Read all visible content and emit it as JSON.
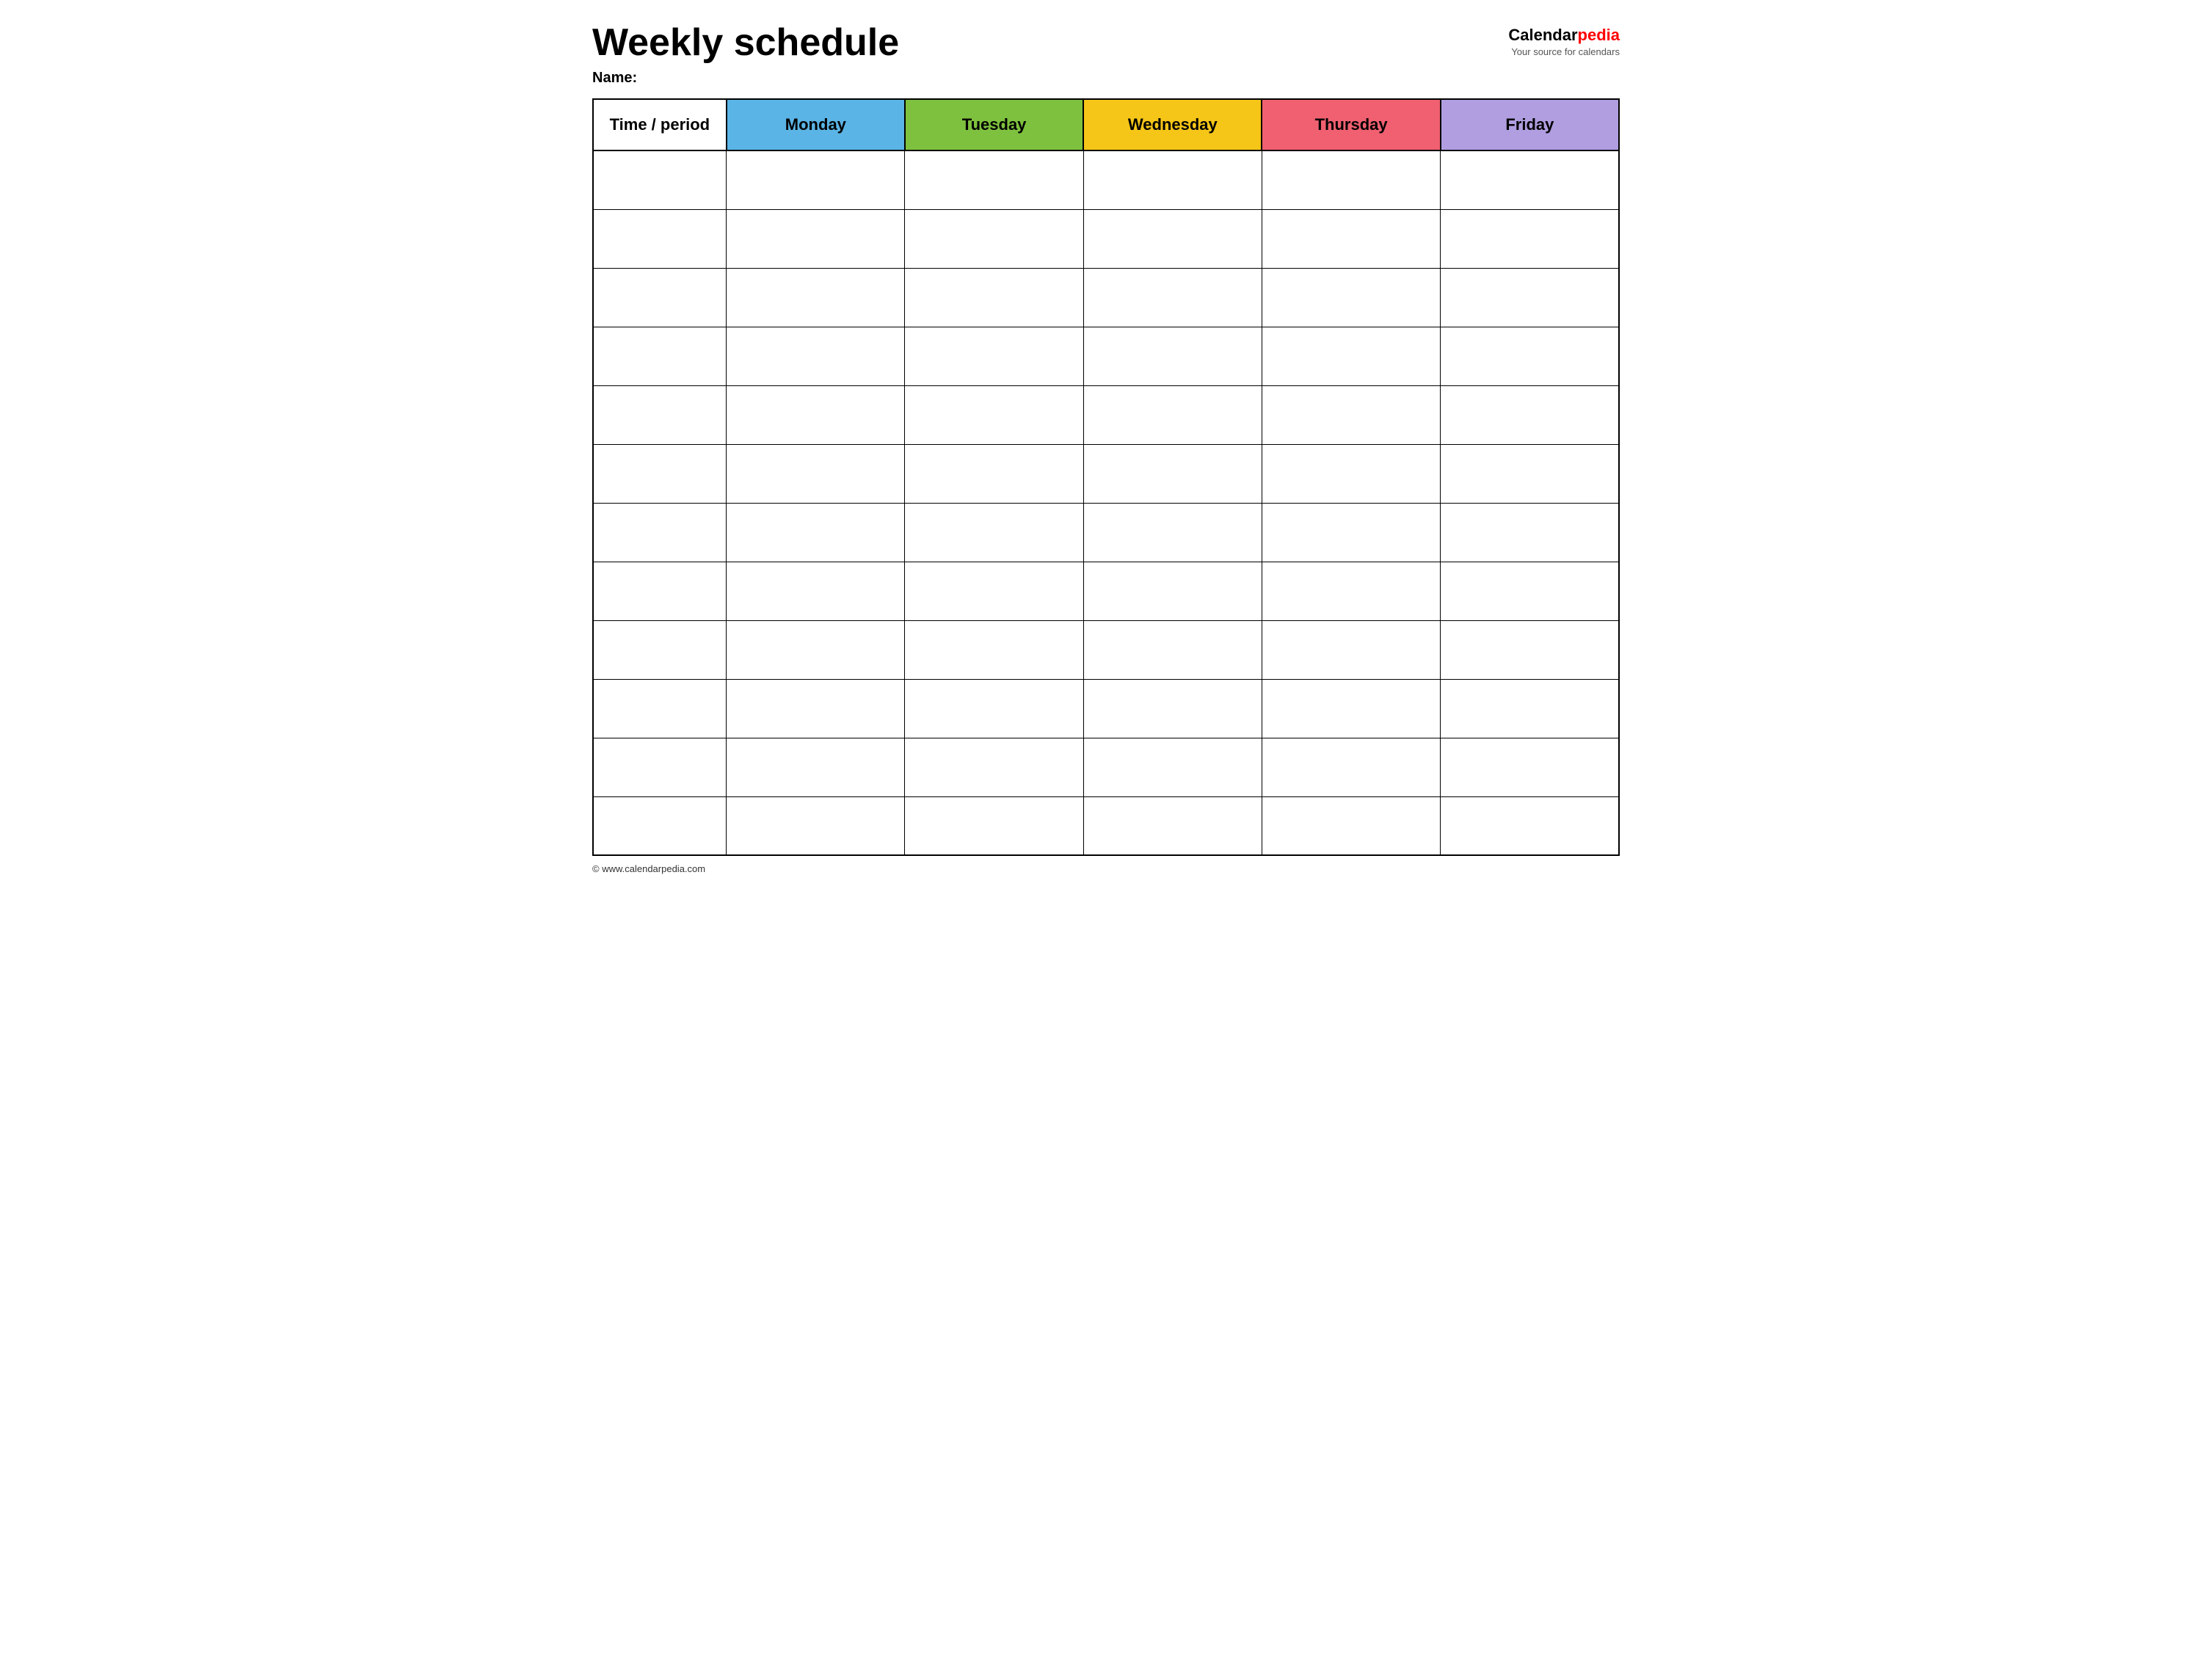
{
  "header": {
    "title": "Weekly schedule",
    "name_label": "Name:",
    "logo": {
      "calendar_part": "Calendar",
      "pedia_part": "pedia",
      "tagline": "Your source for calendars"
    }
  },
  "table": {
    "columns": [
      {
        "id": "time",
        "label": "Time / period",
        "color": "#ffffff"
      },
      {
        "id": "monday",
        "label": "Monday",
        "color": "#5ab4e5"
      },
      {
        "id": "tuesday",
        "label": "Tuesday",
        "color": "#7ec13e"
      },
      {
        "id": "wednesday",
        "label": "Wednesday",
        "color": "#f5c518"
      },
      {
        "id": "thursday",
        "label": "Thursday",
        "color": "#f06070"
      },
      {
        "id": "friday",
        "label": "Friday",
        "color": "#b09ee0"
      }
    ],
    "row_count": 12
  },
  "footer": {
    "copyright": "© www.calendarpedia.com"
  }
}
